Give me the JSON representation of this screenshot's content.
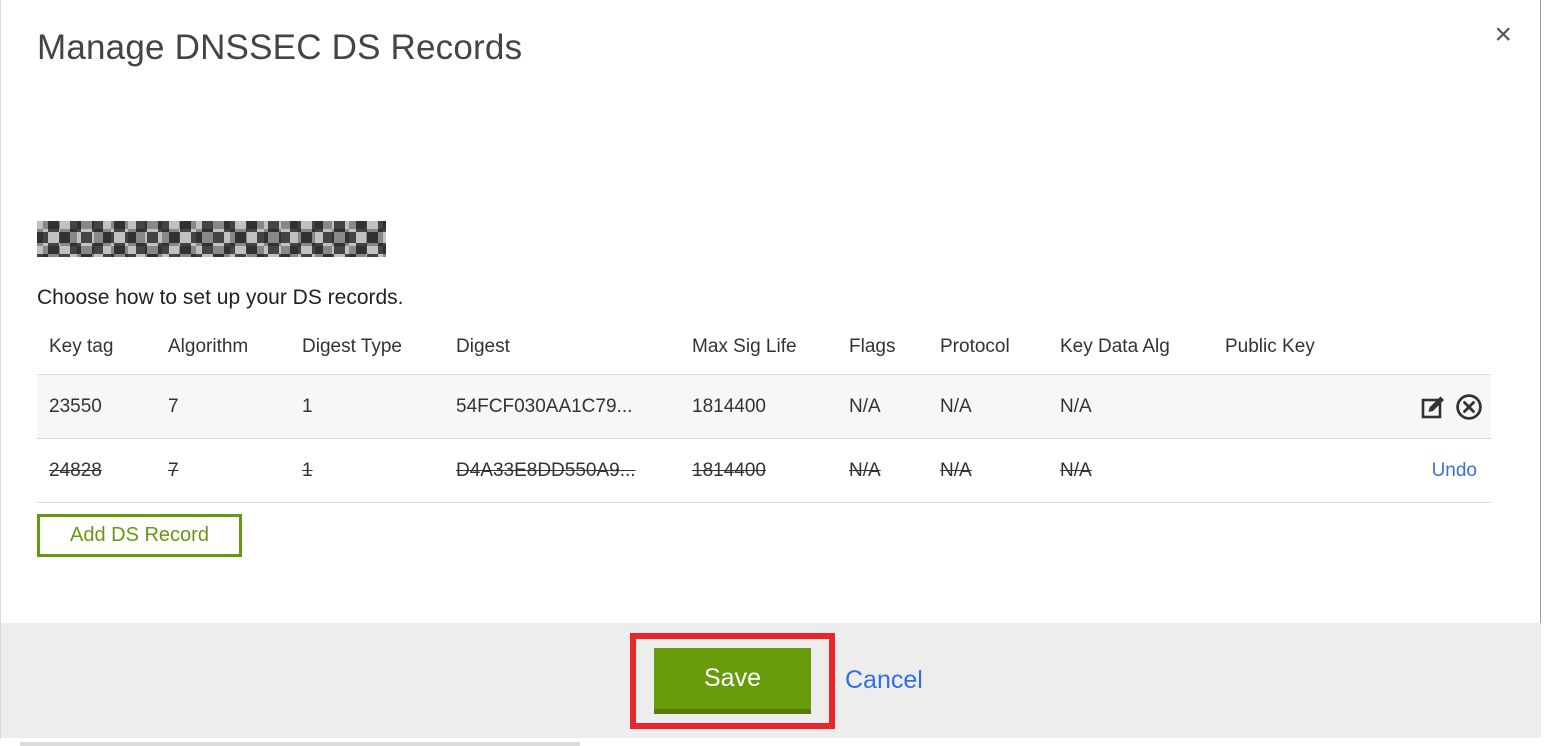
{
  "modal": {
    "title": "Manage DNSSEC DS Records",
    "close_glyph": "×",
    "instruction": "Choose how to set up your DS records.",
    "table": {
      "columns": [
        "Key tag",
        "Algorithm",
        "Digest Type",
        "Digest",
        "Max Sig Life",
        "Flags",
        "Protocol",
        "Key Data Alg",
        "Public Key"
      ],
      "rows": [
        {
          "key_tag": "23550",
          "algorithm": "7",
          "digest_type": "1",
          "digest": "54FCF030AA1C79...",
          "max_sig_life": "1814400",
          "flags": "N/A",
          "protocol": "N/A",
          "key_data_alg": "N/A",
          "public_key": "",
          "state": "normal"
        },
        {
          "key_tag": "24828",
          "algorithm": "7",
          "digest_type": "1",
          "digest": "D4A33E8DD550A9...",
          "max_sig_life": "1814400",
          "flags": "N/A",
          "protocol": "N/A",
          "key_data_alg": "N/A",
          "public_key": "",
          "state": "deleted",
          "undo_label": "Undo"
        }
      ]
    },
    "add_button_label": "Add DS Record",
    "footer": {
      "save_label": "Save",
      "cancel_label": "Cancel"
    }
  },
  "icons": {
    "close": "x-mark",
    "edit": "pencil-on-square",
    "delete": "x-in-circle"
  },
  "colors": {
    "accent_green": "#689b0c",
    "green_outline": "#66990f",
    "link_blue": "#2e6fe8",
    "annotation_red": "#e8262b",
    "footer_gray": "#ededed",
    "row_stripe": "#f7f7f7"
  },
  "annotation": {
    "type": "highlight-rectangle",
    "target": "save-button"
  }
}
